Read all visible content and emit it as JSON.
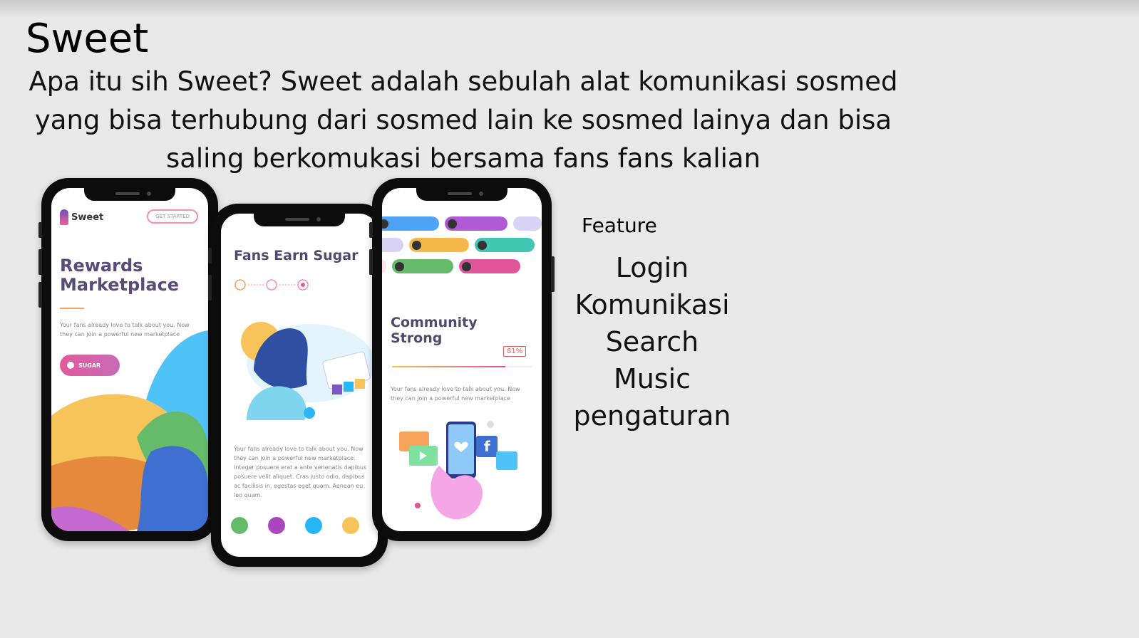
{
  "slide": {
    "title": "Sweet",
    "intro_lines": [
      "Apa itu sih Sweet? Sweet adalah sebulah alat komunikasi sosmed",
      "yang bisa terhubung dari sosmed lain ke sosmed lainya dan bisa",
      "saling berkomukasi bersama fans fans kalian"
    ],
    "feature_heading": "Feature",
    "features": [
      "Login",
      "Komunikasi",
      "Search",
      "Music",
      "pengaturan"
    ]
  },
  "phone1": {
    "logo_text": "Sweet",
    "cta_label": "GET STARTED",
    "headline": "Rewards Marketplace",
    "body": "Your fans already love to talk about you. Now they can join a powerful new marketplace",
    "badge_label": "SUGAR"
  },
  "phone2": {
    "headline": "Fans Earn Sugar",
    "body": "Your fans already love to talk about you. Now they can join a powerful new marketplace. Integer posuere erat a ante venenatis dapibus posuere velit aliquet. Cras justo odio, dapibus ac facilisis in, egestas eget quam. Aenean eu leo quam."
  },
  "phone3": {
    "headline": "Community Strong",
    "percent_label": "81%",
    "progress": 0.81,
    "body": "Your fans already love to talk about you. Now they can join a powerful new marketplace"
  },
  "colors": {
    "background": "#e8e8e8",
    "headline_purple": "#5a4a7a",
    "accent_pink": "#e05c9a",
    "accent_orange": "#f7a35c"
  }
}
